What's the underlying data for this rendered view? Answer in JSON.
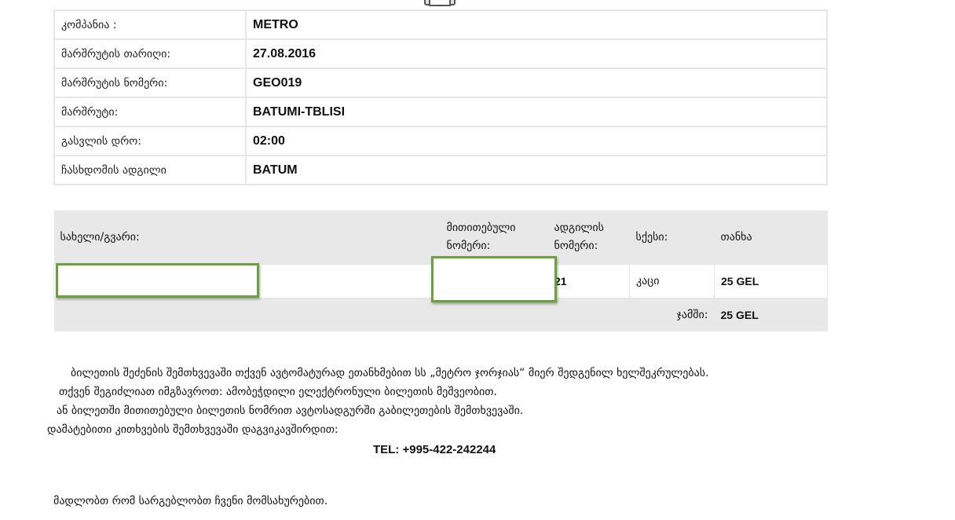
{
  "info": {
    "company_label": "კომპანია :",
    "company_value": "METRO",
    "date_label": "მარშრუტის თარიღი:",
    "date_value": "27.08.2016",
    "route_number_label": "მარშრუტის ნომერი:",
    "route_number_value": "GEO019",
    "route_label": "მარშრუტი:",
    "route_value": "BATUMI-TBLISI",
    "departure_label": "გასვლის დრო:",
    "departure_value": "02:00",
    "boarding_label": "ჩასხდომის ადგილი",
    "boarding_value": "BATUM"
  },
  "passenger_table": {
    "headers": {
      "name": "სახელი/გვარი:",
      "ticket_number_line1": "მითითებული",
      "ticket_number_line2": "ნომერი:",
      "seat_line1": "ადგილის",
      "seat_line2": "ნომერი:",
      "gender": "სქესი:",
      "amount": "თანხა"
    },
    "row": {
      "name": "",
      "ticket_number": "",
      "seat": "21",
      "gender": "კაცი",
      "amount": "25 GEL"
    },
    "total_label": "ჯამში:",
    "total_value": "25 GEL"
  },
  "notes": {
    "line1": "ბილეთის შეძენის შემთხვევაში თქვენ ავტომატურად ეთანხმებით სს „მეტრო ჯორჯიას“ მიერ შედგენილ ხელშეკრულებას.",
    "line2": "თქვენ შეგიძლიათ იმგზავროთ: ამობეჭდილი ელექტრონული ბილეთის მეშვეობით.",
    "line3": "ან ბილეთში მითითებული ბილეთის ნომრით ავტოსადგურში გაბილეთების შემთხვევაში.",
    "line4": "დამატებითი კითხვების შემთხვევაში დაგვიკავშირდით:",
    "tel": "TEL: +995-422-242244",
    "thanks": "მადლობთ რომ სარგებლობთ ჩვენი მომსახურებით."
  },
  "icons": {
    "print": "printer-icon"
  },
  "colors": {
    "highlight_border": "#6aa23a",
    "header_bg": "#e8e8e8",
    "border": "#e6e6e6"
  }
}
